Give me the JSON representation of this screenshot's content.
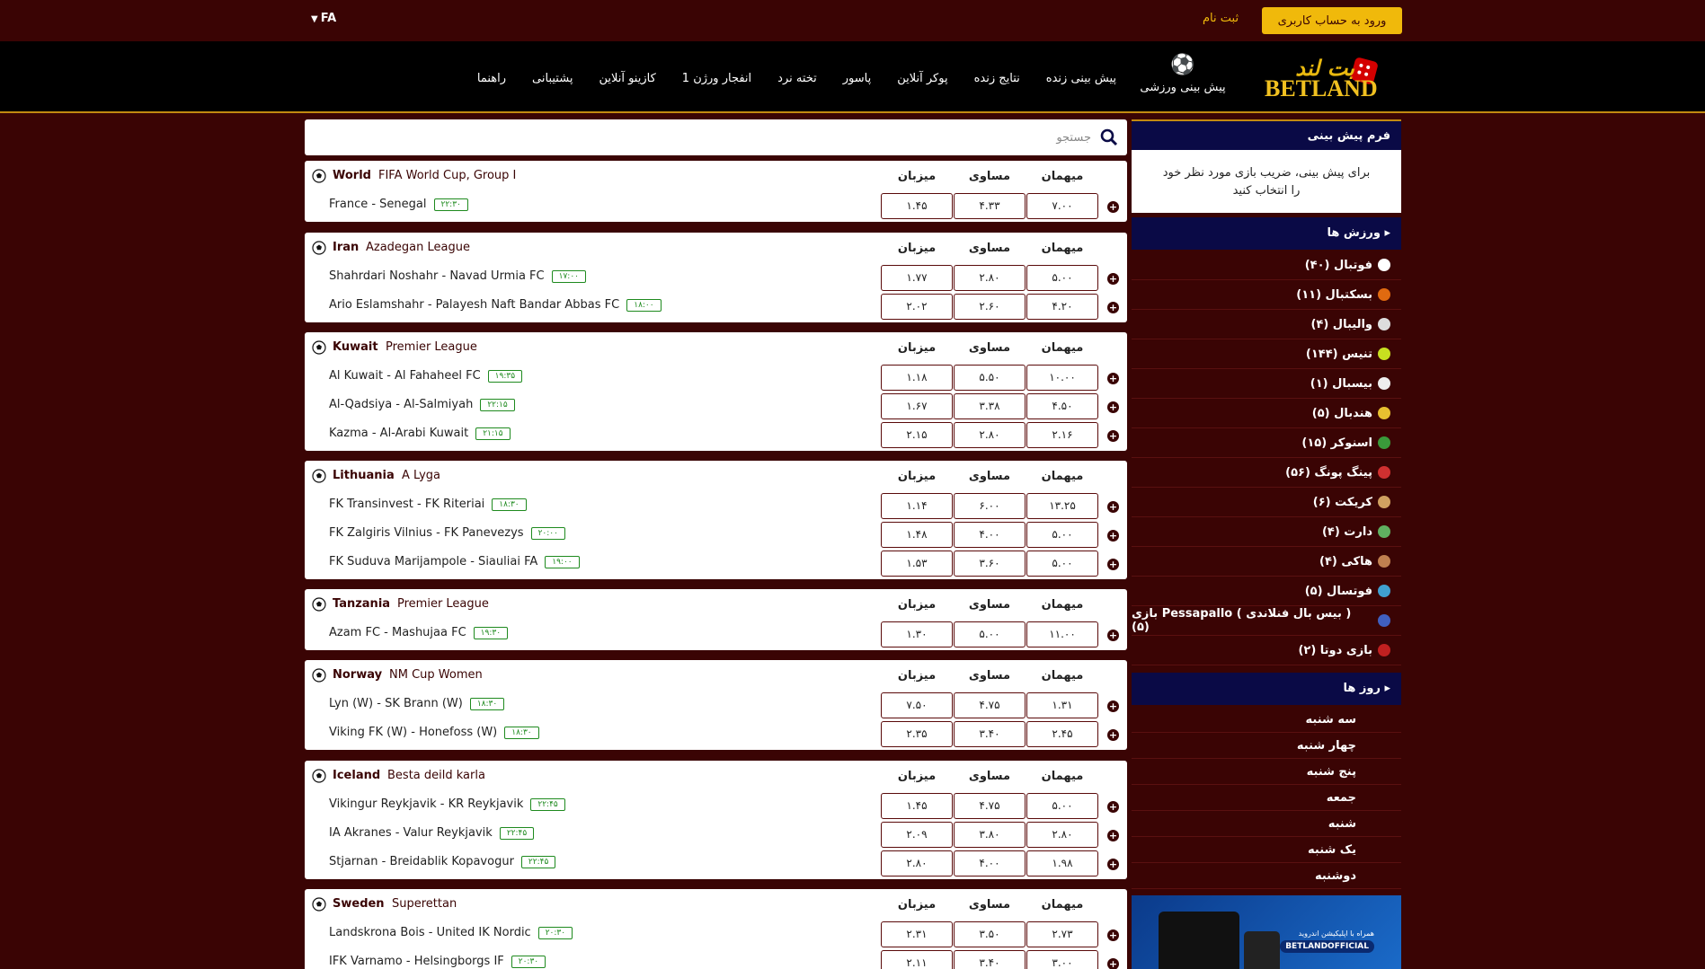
{
  "topbar": {
    "lang": "FA",
    "login": "ورود به حساب کاربری",
    "register": "ثبت نام"
  },
  "nav": {
    "sport": "پیش بینی ورزشی",
    "items": [
      "پیش بینی زنده",
      "نتایج زنده",
      "پوکر آنلاین",
      "پاسور",
      "تخته نرد",
      "انفجار ورژن 1",
      "کازینو آنلاین",
      "پشتیبانی",
      "راهنما"
    ]
  },
  "logo": {
    "fa": "بت لند",
    "en": "BETLAND"
  },
  "search": {
    "placeholder": "جستجو"
  },
  "columns": {
    "home_away": "میهمان",
    "draw": "مساوی",
    "host": "میزبان"
  },
  "leagues": [
    {
      "country": "World",
      "name": "FIFA World Cup, Group I",
      "matches": [
        {
          "teams": "France  -  Senegal",
          "time": "۲۲:۳۰",
          "o1": "۱.۴۵",
          "o2": "۴.۳۳",
          "o3": "۷.۰۰"
        }
      ]
    },
    {
      "country": "Iran",
      "name": "Azadegan League",
      "matches": [
        {
          "teams": "Shahrdari Noshahr  -  Navad Urmia FC",
          "time": "۱۷:۰۰",
          "o1": "۱.۷۷",
          "o2": "۲.۸۰",
          "o3": "۵.۰۰"
        },
        {
          "teams": "Ario Eslamshahr  -  Palayesh Naft Bandar Abbas FC",
          "time": "۱۸:۰۰",
          "o1": "۲.۰۲",
          "o2": "۲.۶۰",
          "o3": "۴.۲۰"
        }
      ]
    },
    {
      "country": "Kuwait",
      "name": "Premier League",
      "matches": [
        {
          "teams": "Al Kuwait  -  Al Fahaheel FC",
          "time": "۱۹:۳۵",
          "o1": "۱.۱۸",
          "o2": "۵.۵۰",
          "o3": "۱۰.۰۰"
        },
        {
          "teams": "Al-Qadsiya  -  Al-Salmiyah",
          "time": "۲۲:۱۵",
          "o1": "۱.۶۷",
          "o2": "۳.۳۸",
          "o3": "۴.۵۰"
        },
        {
          "teams": "Kazma  -  Al-Arabi Kuwait",
          "time": "۲۱:۱۵",
          "o1": "۲.۱۵",
          "o2": "۲.۸۰",
          "o3": "۲.۱۶"
        }
      ]
    },
    {
      "country": "Lithuania",
      "name": "A Lyga",
      "matches": [
        {
          "teams": "FK Transinvest  -  FK Riteriai",
          "time": "۱۸:۳۰",
          "o1": "۱.۱۴",
          "o2": "۶.۰۰",
          "o3": "۱۳.۲۵"
        },
        {
          "teams": "FK Zalgiris Vilnius  -  FK Panevezys",
          "time": "۲۰:۰۰",
          "o1": "۱.۴۸",
          "o2": "۴.۰۰",
          "o3": "۵.۰۰"
        },
        {
          "teams": "FK Suduva Marijampole  -  Siauliai FA",
          "time": "۱۹:۰۰",
          "o1": "۱.۵۳",
          "o2": "۳.۶۰",
          "o3": "۵.۰۰"
        }
      ]
    },
    {
      "country": "Tanzania",
      "name": "Premier League",
      "matches": [
        {
          "teams": "Azam FC  -  Mashujaa FC",
          "time": "۱۹:۳۰",
          "o1": "۱.۳۰",
          "o2": "۵.۰۰",
          "o3": "۱۱.۰۰"
        }
      ]
    },
    {
      "country": "Norway",
      "name": "NM Cup Women",
      "matches": [
        {
          "teams": "Lyn (W)  -  SK Brann (W)",
          "time": "۱۸:۳۰",
          "o1": "۷.۵۰",
          "o2": "۴.۷۵",
          "o3": "۱.۳۱"
        },
        {
          "teams": "Viking FK (W)  -  Honefoss (W)",
          "time": "۱۸:۳۰",
          "o1": "۲.۳۵",
          "o2": "۳.۴۰",
          "o3": "۲.۴۵"
        }
      ]
    },
    {
      "country": "Iceland",
      "name": "Besta deild karla",
      "matches": [
        {
          "teams": "Vikingur Reykjavik  -  KR Reykjavik",
          "time": "۲۲:۴۵",
          "o1": "۱.۴۵",
          "o2": "۴.۷۵",
          "o3": "۵.۰۰"
        },
        {
          "teams": "IA Akranes  -  Valur Reykjavik",
          "time": "۲۲:۴۵",
          "o1": "۲.۰۹",
          "o2": "۳.۸۰",
          "o3": "۲.۸۰"
        },
        {
          "teams": "Stjarnan  -  Breidablik Kopavogur",
          "time": "۲۲:۴۵",
          "o1": "۲.۸۰",
          "o2": "۴.۰۰",
          "o3": "۱.۹۸"
        }
      ]
    },
    {
      "country": "Sweden",
      "name": "Superettan",
      "matches": [
        {
          "teams": "Landskrona Bois  -  United IK Nordic",
          "time": "۲۰:۳۰",
          "o1": "۲.۳۱",
          "o2": "۳.۵۰",
          "o3": "۲.۷۳"
        },
        {
          "teams": "IFK Varnamo  -  Helsingborgs IF",
          "time": "۲۰:۳۰",
          "o1": "۲.۱۱",
          "o2": "۳.۴۰",
          "o3": "۳.۰۰"
        }
      ]
    }
  ],
  "bet_form": {
    "title": "فرم پیش بینی",
    "body": "برای پیش بینی، ضریب بازی مورد نظر خود را انتخاب کنید"
  },
  "sports_header": "ورزش ها",
  "sports": [
    {
      "label": "فوتبال (۴۰)",
      "icon": "football-icon",
      "color": "#ffffff"
    },
    {
      "label": "بسکتبال (۱۱)",
      "icon": "basketball-icon",
      "color": "#e06a10"
    },
    {
      "label": "والیبال (۴)",
      "icon": "volleyball-icon",
      "color": "#dddddd"
    },
    {
      "label": "تنیس (۱۴۴)",
      "icon": "tennis-icon",
      "color": "#c8e020"
    },
    {
      "label": "بیسبال (۱)",
      "icon": "baseball-icon",
      "color": "#eeeeee"
    },
    {
      "label": "هندبال (۵)",
      "icon": "handball-icon",
      "color": "#e8c030"
    },
    {
      "label": "اسنوکر (۱۵)",
      "icon": "snooker-icon",
      "color": "#3a9a3a"
    },
    {
      "label": "پینگ پونگ (۵۶)",
      "icon": "pingpong-icon",
      "color": "#d03030"
    },
    {
      "label": "کریکت (۶)",
      "icon": "cricket-icon",
      "color": "#d0a060"
    },
    {
      "label": "دارت (۴)",
      "icon": "darts-icon",
      "color": "#60b060"
    },
    {
      "label": "هاکی (۴)",
      "icon": "hockey-icon",
      "color": "#c08050"
    },
    {
      "label": "فوتسال (۵)",
      "icon": "futsal-icon",
      "color": "#40a0d0"
    },
    {
      "label": "بازی Pessapallo ( بیس بال فنلاندی ) (۵)",
      "icon": "pessapallo-icon",
      "color": "#4060c0"
    },
    {
      "label": "بازی دوتا (۲)",
      "icon": "dota-icon",
      "color": "#c02020"
    }
  ],
  "days_header": "روز ها",
  "days": [
    "سه شنبه",
    "چهار شنبه",
    "پنج شنبه",
    "جمعه",
    "شنبه",
    "یک شنبه",
    "دوشنبه"
  ],
  "banner": {
    "line1": "همراه با اپلیکیشن اندروید",
    "line2": "BETLANDOFFICIAL"
  }
}
